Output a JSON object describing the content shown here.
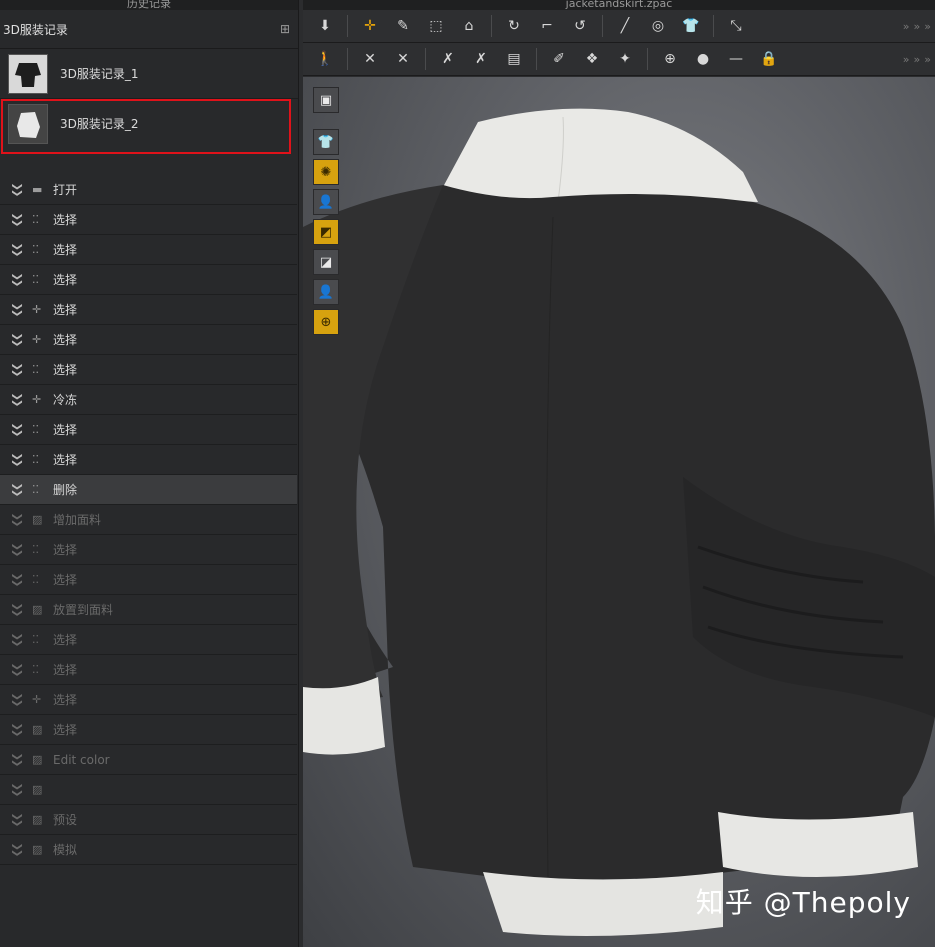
{
  "left_panel": {
    "title": "历史记录",
    "header": "3D服装记录",
    "snapshots": [
      {
        "label": "3D服装记录_1"
      },
      {
        "label": "3D服装记录_2"
      }
    ],
    "history": [
      {
        "label": "打开",
        "icon": "folder-icon",
        "state": "active"
      },
      {
        "label": "选择",
        "icon": "select-icon",
        "state": "active"
      },
      {
        "label": "选择",
        "icon": "select-icon",
        "state": "active"
      },
      {
        "label": "选择",
        "icon": "select-icon",
        "state": "active"
      },
      {
        "label": "选择",
        "icon": "transform-icon",
        "state": "active"
      },
      {
        "label": "选择",
        "icon": "transform-icon",
        "state": "active"
      },
      {
        "label": "选择",
        "icon": "select-icon",
        "state": "active"
      },
      {
        "label": "冷冻",
        "icon": "transform-icon",
        "state": "active"
      },
      {
        "label": "选择",
        "icon": "select-icon",
        "state": "active"
      },
      {
        "label": "选择",
        "icon": "select-icon",
        "state": "active"
      },
      {
        "label": "删除",
        "icon": "select-icon",
        "state": "current"
      },
      {
        "label": "增加面料",
        "icon": "fabric-icon",
        "state": "undone"
      },
      {
        "label": "选择",
        "icon": "select-icon",
        "state": "undone"
      },
      {
        "label": "选择",
        "icon": "select-icon",
        "state": "undone"
      },
      {
        "label": "放置到面料",
        "icon": "fabric-icon",
        "state": "undone"
      },
      {
        "label": "选择",
        "icon": "select-icon",
        "state": "undone"
      },
      {
        "label": "选择",
        "icon": "select-icon",
        "state": "undone"
      },
      {
        "label": "选择",
        "icon": "transform-icon",
        "state": "undone"
      },
      {
        "label": "选择",
        "icon": "fabric-icon",
        "state": "undone"
      },
      {
        "label": "Edit color",
        "icon": "fabric-icon",
        "state": "undone"
      },
      {
        "label": "",
        "icon": "fabric-icon",
        "state": "undone"
      },
      {
        "label": "预设",
        "icon": "fabric-icon",
        "state": "undone"
      },
      {
        "label": "模拟",
        "icon": "fabric-icon",
        "state": "undone"
      }
    ]
  },
  "right_panel": {
    "title": "jacketandskirt.zpac",
    "watermark": "知乎 @Thepoly"
  },
  "colors": {
    "highlight_box": "#e0121a",
    "accent": "#d7a20f"
  }
}
